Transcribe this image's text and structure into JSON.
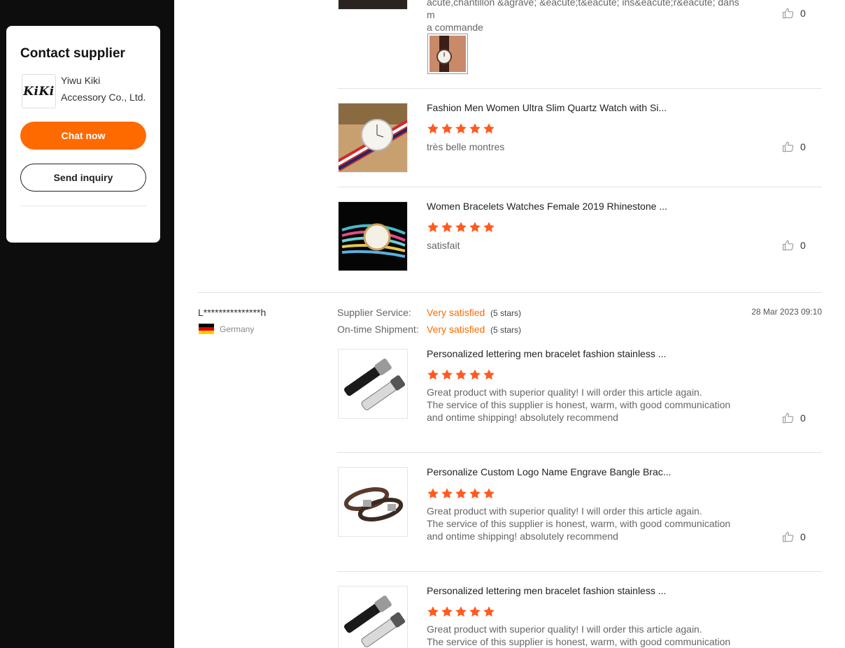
{
  "contact": {
    "title": "Contact supplier",
    "logo_text": "KiKi",
    "supplier_name_line1": "Yiwu Kiki",
    "supplier_name_line2": "Accessory Co., Ltd.",
    "chat_label": "Chat now",
    "inquiry_label": "Send inquiry"
  },
  "colors": {
    "accent": "#ff6a00",
    "star": "#ff5a1f",
    "panel_bg": "#0d0d0d"
  },
  "top_review": {
    "partial_text_line1": "acute,chantillon &agrave; &eacute;t&eacute; ins&eacute;r&eacute; dans m",
    "partial_text_line2": "a commande",
    "likes": "0",
    "items": [
      {
        "title": "Fashion Men Women Ultra Slim Quartz Watch with Si...",
        "rating": 5,
        "text": "très belle montres",
        "likes": "0"
      },
      {
        "title": "Women Bracelets Watches Female 2019 Rhinestone ...",
        "rating": 5,
        "text": "satisfait",
        "likes": "0"
      }
    ]
  },
  "second_review": {
    "reviewer": "L***************h",
    "country": "Germany",
    "date": "28 Mar 2023 09:10",
    "supplier_service_label": "Supplier Service:",
    "supplier_service_value": "Very satisfied",
    "supplier_service_stars": "(5 stars)",
    "shipment_label": "On-time Shipment:",
    "shipment_value": "Very satisfied",
    "shipment_stars": "(5 stars)",
    "items": [
      {
        "title": "Personalized lettering men bracelet fashion stainless ...",
        "rating": 5,
        "line1": "Great product with superior quality! I will order this article again.",
        "line2": "The service of this supplier is honest, warm, with good communication",
        "line3": "and ontime shipping! absolutely recommend",
        "likes": "0"
      },
      {
        "title": "Personalize Custom Logo Name Engrave Bangle Brac...",
        "rating": 5,
        "line1": "Great product with superior quality! I will order this article again.",
        "line2": "The service of this supplier is honest, warm, with good communication",
        "line3": "and ontime shipping! absolutely recommend",
        "likes": "0"
      },
      {
        "title": "Personalized lettering men bracelet fashion stainless ...",
        "rating": 5,
        "line1": "Great product with superior quality! I will order this article again.",
        "line2": "The service of this supplier is honest, warm, with good communication",
        "line3": "",
        "likes": ""
      }
    ]
  }
}
